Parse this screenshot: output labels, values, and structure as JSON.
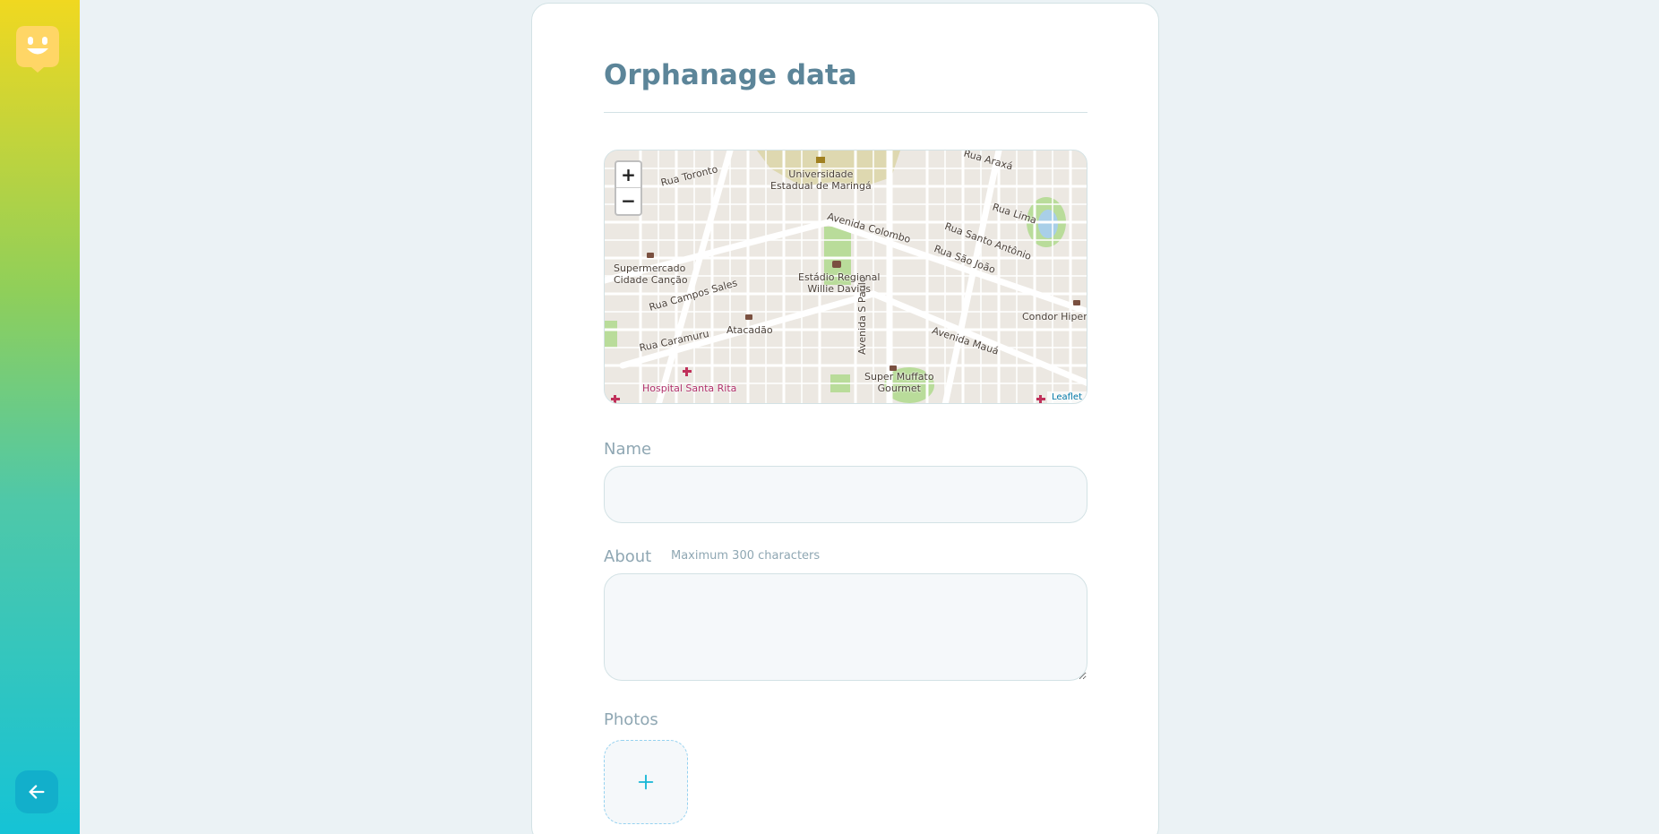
{
  "sidebar": {
    "logo": "happy-face-logo",
    "back_button_icon": "arrow-left-icon"
  },
  "form": {
    "title": "Orphanage data",
    "map": {
      "zoom_in": "+",
      "zoom_out": "−",
      "attribution": "Leaflet",
      "labels": {
        "rua_toronto": "Rua Toronto",
        "universidade": "Universidade\nEstadual de Maringá",
        "avenida_colombo": "Avenida Colombo",
        "rua_araxa": "Rua Araxá",
        "rua_lima": "Rua Lima",
        "rua_santo_antonio": "Rua Santo Antônio",
        "rua_sao_joao": "Rua São João",
        "supermercado": "Supermercado\nCidade Canção",
        "rua_campos_sales": "Rua Campos Sales",
        "estadio": "Estádio Regional\nWillie Davids",
        "avenida_s_paulo": "Avenida S Paulo",
        "condor": "Condor Hiperm",
        "atacadao": "Atacadão",
        "rua_caramuru": "Rua Caramuru",
        "avenida_maua": "Avenida Mauá",
        "super_muffato": "Super Muffato\nGourmet",
        "hospital": "Hospital Santa Rita"
      }
    },
    "name_label": "Name",
    "name_value": "",
    "about_label": "About",
    "about_hint": "Maximum 300 characters",
    "about_value": "",
    "photos_label": "Photos",
    "add_photo_icon": "plus-icon"
  }
}
